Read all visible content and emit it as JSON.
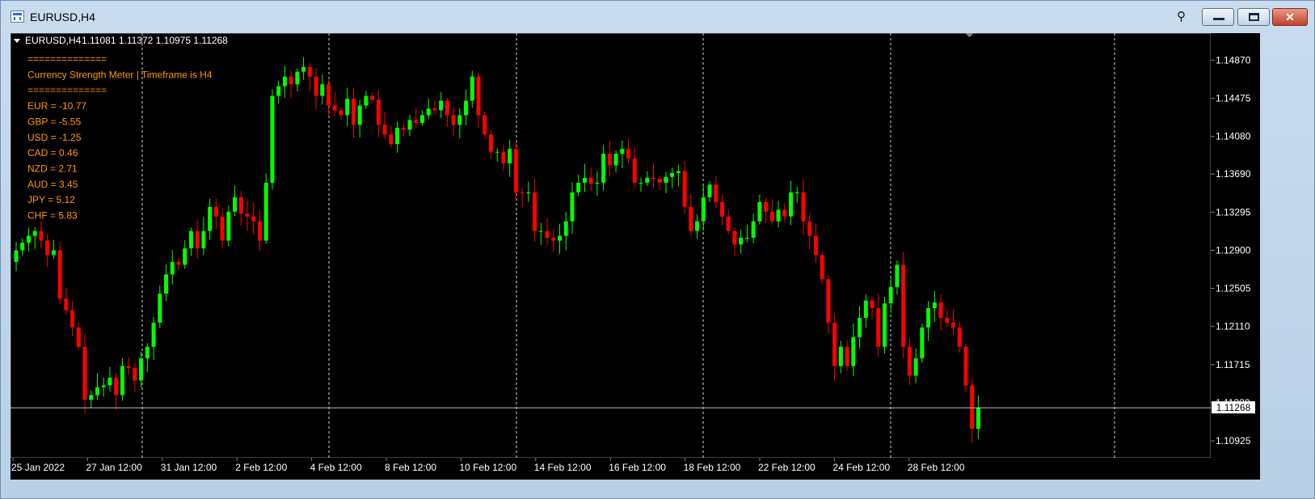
{
  "window": {
    "title": "EURUSD,H4",
    "icons": [
      "chart-window-icon",
      "pin-icon",
      "minimize-icon",
      "maximize-icon",
      "close-icon"
    ]
  },
  "chart": {
    "header_symbol": "EURUSD,H4",
    "header_ohlc": "1.11081 1.11372 1.10975 1.11268",
    "current_price_label": "1.11268",
    "indicator_lines": [
      "==============",
      "Currency Strength Meter | Timeframe is H4",
      "==============",
      "EUR = -10.77",
      "GBP = -5.55",
      "USD = -1.25",
      "CAD = 0.46",
      "NZD = 2.71",
      "AUD = 3.45",
      "JPY = 5.12",
      "CHF = 5.83"
    ],
    "price_ticks": [
      "1.14870",
      "1.14475",
      "1.14080",
      "1.13690",
      "1.13295",
      "1.12900",
      "1.12505",
      "1.12110",
      "1.11715",
      "1.11320",
      "1.10925"
    ],
    "time_ticks": [
      "25 Jan 2022",
      "27 Jan 12:00",
      "31 Jan 12:00",
      "2 Feb 12:00",
      "4 Feb 12:00",
      "8 Feb 12:00",
      "10 Feb 12:00",
      "14 Feb 12:00",
      "16 Feb 12:00",
      "18 Feb 12:00",
      "22 Feb 12:00",
      "24 Feb 12:00",
      "28 Feb 12:00"
    ],
    "colors": {
      "background": "#000000",
      "bull": "#00ff00",
      "bear": "#ff0000",
      "text": "#ffffff",
      "indicator_text": "#ff9900",
      "grid": "#ffffff"
    }
  },
  "chart_data": {
    "type": "candlestick",
    "symbol": "EURUSD",
    "timeframe": "H4",
    "ylim": [
      1.1075,
      1.1515
    ],
    "last_close": 1.11268,
    "close": [
      1.129,
      1.1298,
      1.1305,
      1.131,
      1.13,
      1.1285,
      1.129,
      1.124,
      1.1228,
      1.121,
      1.119,
      1.1135,
      1.114,
      1.1148,
      1.115,
      1.1158,
      1.114,
      1.117,
      1.1168,
      1.1155,
      1.1178,
      1.119,
      1.1215,
      1.1245,
      1.1265,
      1.1278,
      1.1275,
      1.1292,
      1.131,
      1.1292,
      1.131,
      1.1335,
      1.1325,
      1.13,
      1.133,
      1.1345,
      1.1328,
      1.1325,
      1.132,
      1.13,
      1.136,
      1.145,
      1.146,
      1.147,
      1.1462,
      1.1475,
      1.148,
      1.147,
      1.145,
      1.1462,
      1.144,
      1.1435,
      1.143,
      1.1447,
      1.142,
      1.144,
      1.145,
      1.1446,
      1.142,
      1.141,
      1.14,
      1.1417,
      1.1415,
      1.1425,
      1.1422,
      1.143,
      1.1437,
      1.1435,
      1.1445,
      1.143,
      1.142,
      1.143,
      1.1445,
      1.147,
      1.143,
      1.141,
      1.1392,
      1.1392,
      1.138,
      1.1395,
      1.135,
      1.1349,
      1.135,
      1.131,
      1.131,
      1.1303,
      1.13,
      1.1305,
      1.132,
      1.135,
      1.136,
      1.1365,
      1.1359,
      1.136,
      1.139,
      1.1378,
      1.139,
      1.1395,
      1.1385,
      1.136,
      1.136,
      1.1365,
      1.1364,
      1.136,
      1.1366,
      1.137,
      1.1372,
      1.1335,
      1.131,
      1.132,
      1.1345,
      1.1358,
      1.134,
      1.1325,
      1.131,
      1.1296,
      1.1303,
      1.1303,
      1.132,
      1.134,
      1.133,
      1.132,
      1.1332,
      1.1325,
      1.135,
      1.135,
      1.132,
      1.1305,
      1.1285,
      1.126,
      1.1215,
      1.117,
      1.119,
      1.117,
      1.12,
      1.122,
      1.1238,
      1.123,
      1.119,
      1.1235,
      1.1252,
      1.1275,
      1.119,
      1.116,
      1.1178,
      1.121,
      1.123,
      1.1236,
      1.122,
      1.1215,
      1.121,
      1.119,
      1.115,
      1.1105,
      1.1127
    ]
  }
}
